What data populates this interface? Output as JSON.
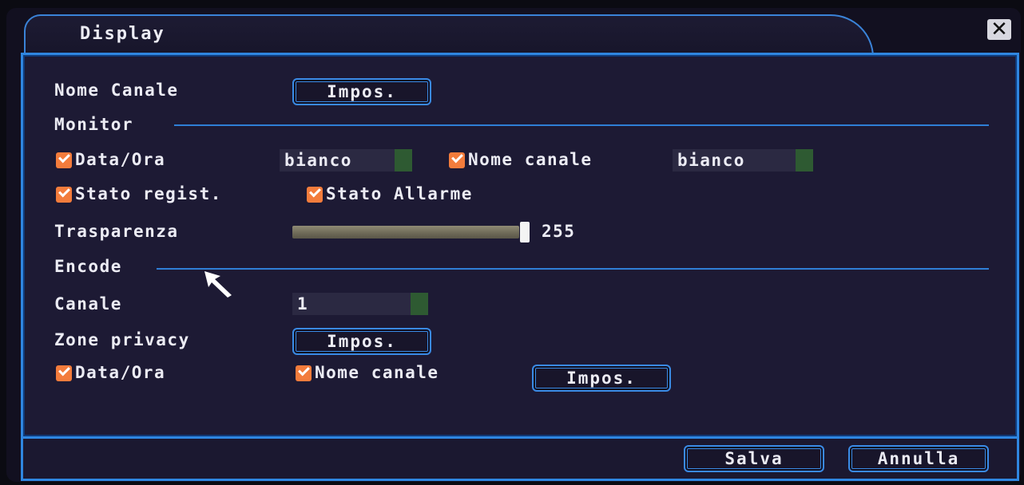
{
  "window": {
    "title": "Display",
    "close_icon": "close-icon"
  },
  "nome_canale_row": {
    "label": "Nome Canale",
    "button": "Impos."
  },
  "monitor": {
    "section_title": "Monitor",
    "date_time": {
      "label": "Data/Ora",
      "checked": true,
      "color": "bianco"
    },
    "channel_name": {
      "label": "Nome canale",
      "checked": true,
      "color": "bianco"
    },
    "record_status": {
      "label": "Stato regist.",
      "checked": true
    },
    "alarm_status": {
      "label": "Stato Allarme",
      "checked": true
    },
    "transparency": {
      "label": "Trasparenza",
      "value": "255",
      "level": 1.0
    }
  },
  "encode": {
    "section_title": "Encode",
    "channel": {
      "label": "Canale",
      "value": "1"
    },
    "privacy_zones": {
      "label": "Zone privacy",
      "button": "Impos."
    },
    "date_time": {
      "label": "Data/Ora",
      "checked": true
    },
    "channel_name": {
      "label": "Nome canale",
      "checked": true
    },
    "overlay_button": "Impos."
  },
  "footer": {
    "save": "Salva",
    "cancel": "Annulla"
  },
  "colors": {
    "accent": "#2f86e0",
    "checkbox": "#f37c3c",
    "panel": "#1d1a34"
  }
}
